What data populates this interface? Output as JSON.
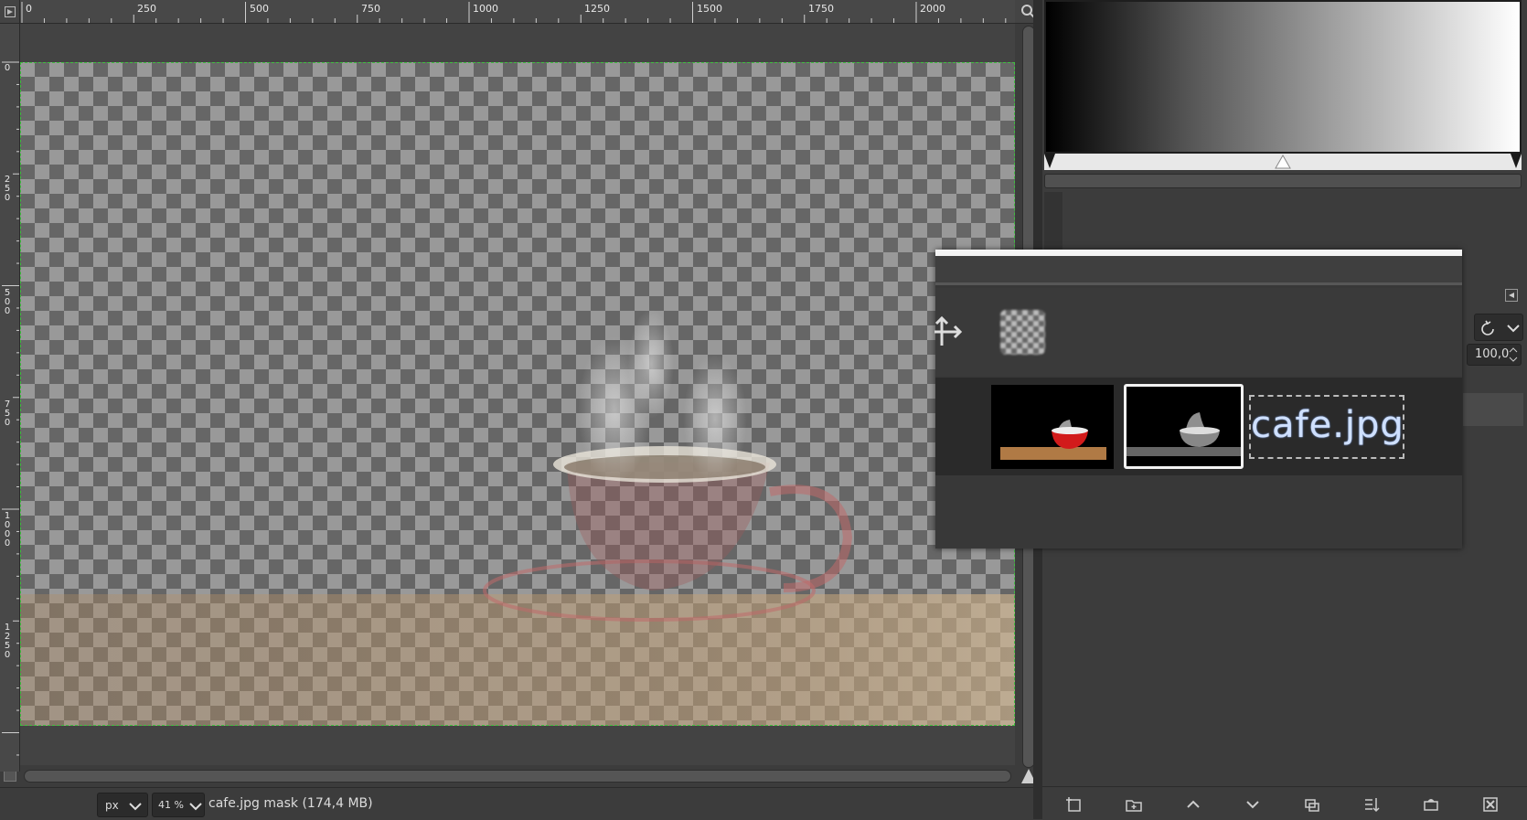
{
  "ruler": {
    "h_ticks": [
      "0",
      "250",
      "500",
      "750",
      "1000",
      "1250",
      "1500",
      "1750",
      "2000"
    ],
    "v_ticks": [
      "0",
      "250",
      "500",
      "750",
      "1000",
      "1250"
    ]
  },
  "statusbar": {
    "unit": "px",
    "zoom": "41 %",
    "text": "cafe.jpg mask (174,4 MB)"
  },
  "layers": {
    "opacity": "100,0",
    "layer_name": "cafe.jpg"
  },
  "icons": {
    "ruler_corner": "ruler-toggle-icon",
    "zoom": "zoom-icon",
    "navigate": "navigate-icon",
    "mode_reset": "reset-icon",
    "move": "move-icon",
    "alpha": "checkerboard-icon"
  },
  "colors": {
    "selection_outline": "#3fbf3f",
    "panel_bg": "#3c3c3c"
  }
}
